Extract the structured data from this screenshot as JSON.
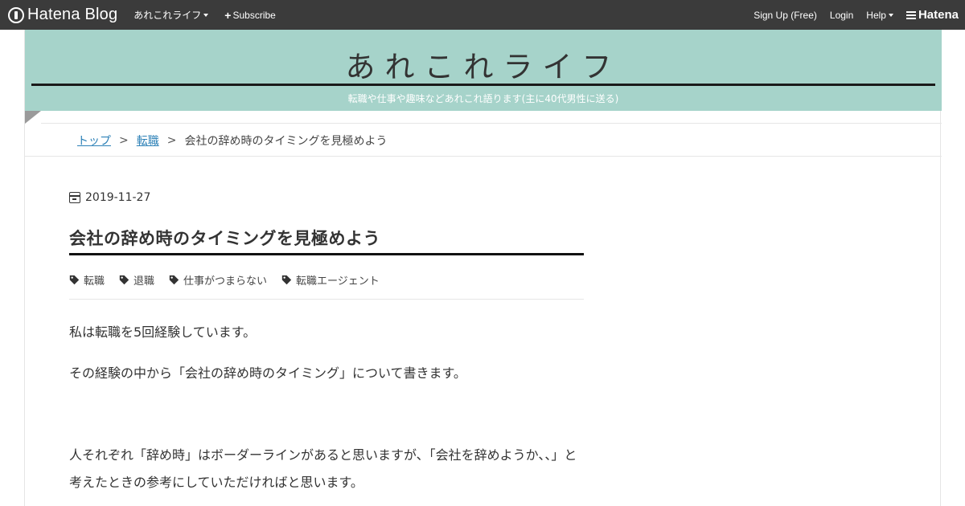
{
  "globalbar": {
    "logo_text": "Hatena Blog",
    "blog_menu": "あれこれライフ",
    "subscribe": "Subscribe",
    "signup": "Sign Up (Free)",
    "login": "Login",
    "help": "Help",
    "hatena": "Hatena"
  },
  "header": {
    "title": "あれこれライフ",
    "description": "転職や仕事や趣味などあれこれ語ります(主に40代男性に送る)"
  },
  "breadcrumb": {
    "top": "トップ",
    "sep1": ">",
    "category": "転職",
    "sep2": ">",
    "current": "会社の辞め時のタイミングを見極めよう"
  },
  "article": {
    "date": "2019-11-27",
    "title": "会社の辞め時のタイミングを見極めよう",
    "categories": [
      "転職",
      "退職",
      "仕事がつまらない",
      "転職エージェント"
    ],
    "paragraphs": [
      "私は転職を5回経験しています。",
      "その経験の中から「会社の辞め時のタイミング」について書きます。",
      "人それぞれ「辞め時」はボーダーラインがあると思いますが、「会社を辞めようか、、」と考えたときの参考にしていただければと思います。"
    ]
  },
  "colors": {
    "globalbar_bg": "#3b3b3b",
    "header_bg": "#a6d3ca",
    "link": "#2d81b7"
  }
}
